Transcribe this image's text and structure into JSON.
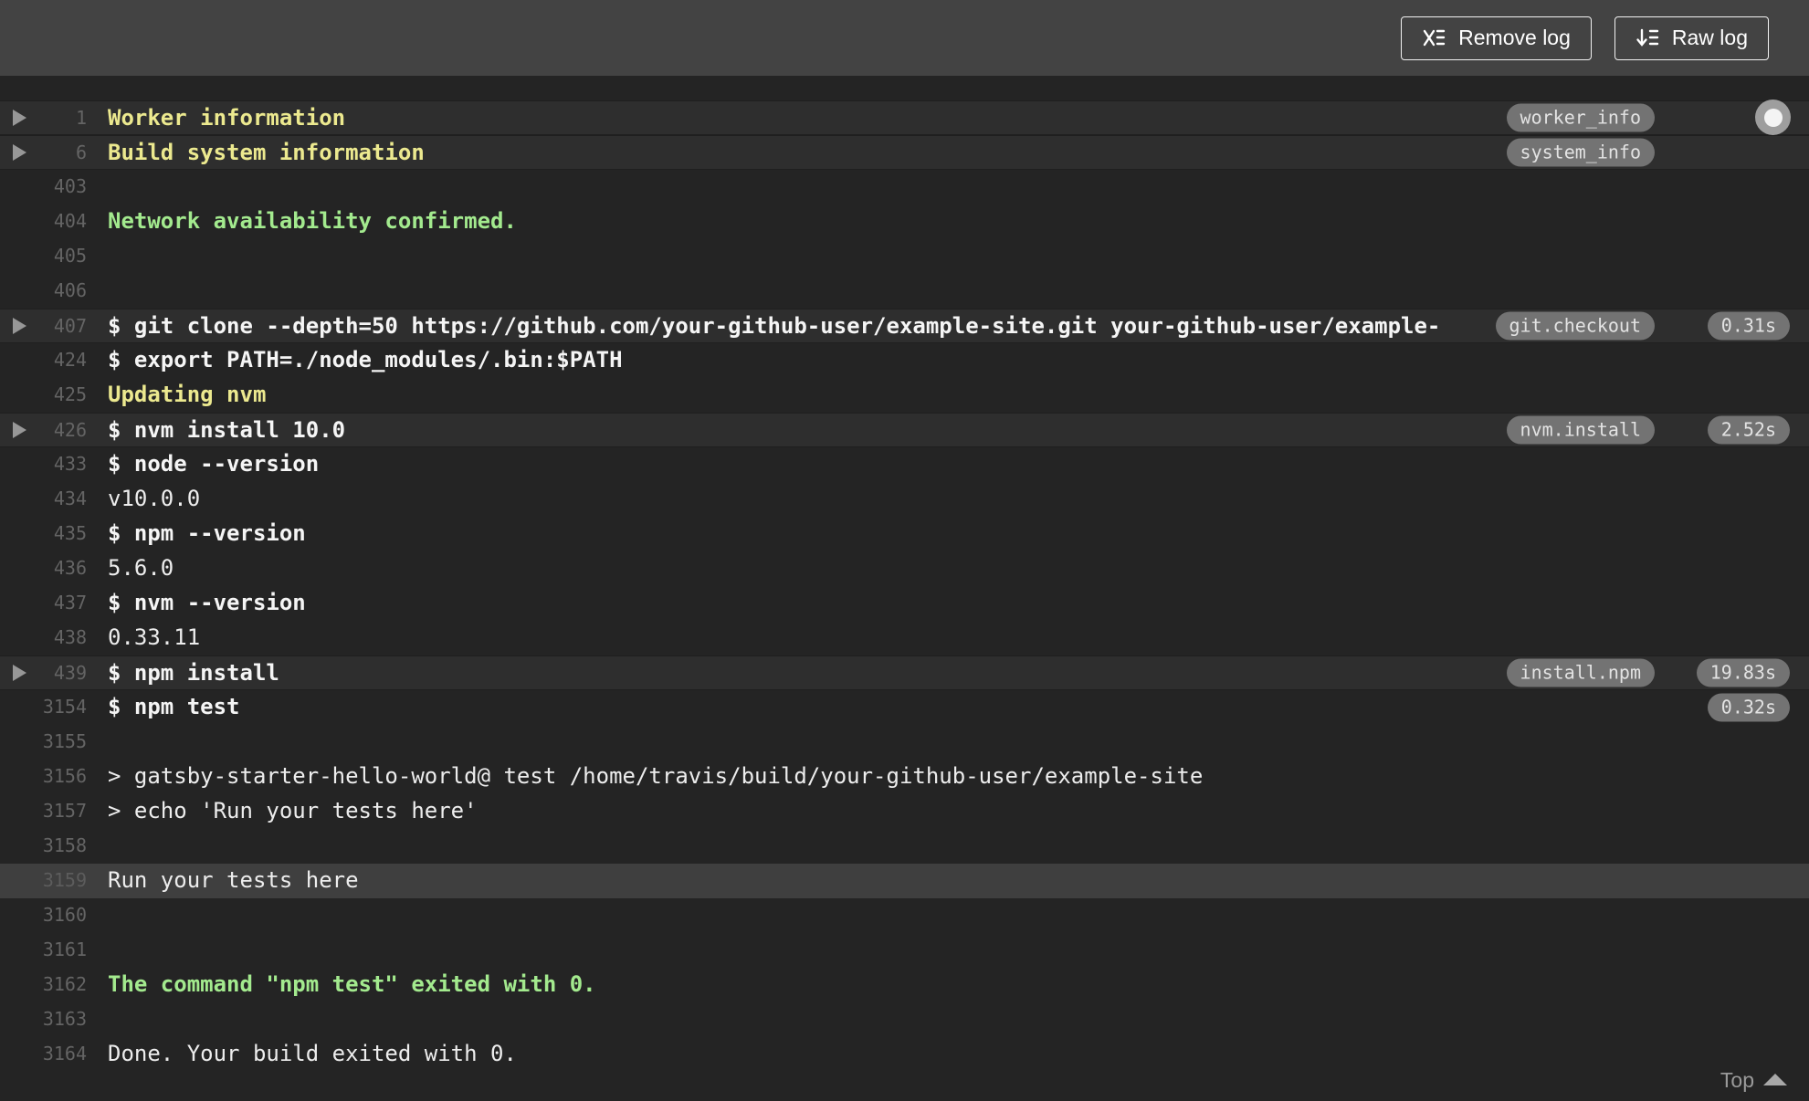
{
  "toolbar": {
    "remove_log_label": "Remove log",
    "raw_log_label": "Raw log"
  },
  "colors": {
    "topbar_bg": "#434343",
    "log_bg": "#242424",
    "fold_row_bg": "#2e2e2e",
    "selected_row_bg": "#3f3f3f",
    "command_text": "#f5f5f5",
    "output_text": "#ededed",
    "section_yellow": "#ece98f",
    "status_green": "#a3ea8e",
    "line_number": "#646464",
    "badge_bg": "#737373",
    "badge_text": "#e3e3e3"
  },
  "log": {
    "lines": [
      {
        "number": "1",
        "text": "Worker information",
        "style": "yellow",
        "fold_arrow": true,
        "badge": "worker_info",
        "timing": null,
        "row": "fold"
      },
      {
        "number": "6",
        "text": "Build system information",
        "style": "yellow",
        "fold_arrow": true,
        "badge": "system_info",
        "timing": null,
        "row": "fold"
      },
      {
        "number": "403",
        "text": "",
        "style": "out",
        "fold_arrow": false,
        "badge": null,
        "timing": null,
        "row": "normal"
      },
      {
        "number": "404",
        "text": "Network availability confirmed.",
        "style": "green",
        "fold_arrow": false,
        "badge": null,
        "timing": null,
        "row": "normal"
      },
      {
        "number": "405",
        "text": "",
        "style": "out",
        "fold_arrow": false,
        "badge": null,
        "timing": null,
        "row": "normal"
      },
      {
        "number": "406",
        "text": "",
        "style": "out",
        "fold_arrow": false,
        "badge": null,
        "timing": null,
        "row": "normal"
      },
      {
        "number": "407",
        "text": "$ git clone --depth=50 https://github.com/your-github-user/example-site.git your-github-user/example-",
        "style": "cmd",
        "fold_arrow": true,
        "badge": "git.checkout",
        "timing": "0.31s",
        "row": "fold"
      },
      {
        "number": "424",
        "text": "$ export PATH=./node_modules/.bin:$PATH",
        "style": "cmd",
        "fold_arrow": false,
        "badge": null,
        "timing": null,
        "row": "normal"
      },
      {
        "number": "425",
        "text": "Updating nvm",
        "style": "yellow",
        "fold_arrow": false,
        "badge": null,
        "timing": null,
        "row": "normal"
      },
      {
        "number": "426",
        "text": "$ nvm install 10.0",
        "style": "cmd",
        "fold_arrow": true,
        "badge": "nvm.install",
        "timing": "2.52s",
        "row": "fold"
      },
      {
        "number": "433",
        "text": "$ node --version",
        "style": "cmd",
        "fold_arrow": false,
        "badge": null,
        "timing": null,
        "row": "normal"
      },
      {
        "number": "434",
        "text": "v10.0.0",
        "style": "out",
        "fold_arrow": false,
        "badge": null,
        "timing": null,
        "row": "normal"
      },
      {
        "number": "435",
        "text": "$ npm --version",
        "style": "cmd",
        "fold_arrow": false,
        "badge": null,
        "timing": null,
        "row": "normal"
      },
      {
        "number": "436",
        "text": "5.6.0",
        "style": "out",
        "fold_arrow": false,
        "badge": null,
        "timing": null,
        "row": "normal"
      },
      {
        "number": "437",
        "text": "$ nvm --version",
        "style": "cmd",
        "fold_arrow": false,
        "badge": null,
        "timing": null,
        "row": "normal"
      },
      {
        "number": "438",
        "text": "0.33.11",
        "style": "out",
        "fold_arrow": false,
        "badge": null,
        "timing": null,
        "row": "normal"
      },
      {
        "number": "439",
        "text": "$ npm install",
        "style": "cmd",
        "fold_arrow": true,
        "badge": "install.npm",
        "timing": "19.83s",
        "row": "fold"
      },
      {
        "number": "3154",
        "text": "$ npm test",
        "style": "cmd",
        "fold_arrow": false,
        "badge": null,
        "timing": "0.32s",
        "row": "normal"
      },
      {
        "number": "3155",
        "text": "",
        "style": "out",
        "fold_arrow": false,
        "badge": null,
        "timing": null,
        "row": "normal"
      },
      {
        "number": "3156",
        "text": "> gatsby-starter-hello-world@ test /home/travis/build/your-github-user/example-site",
        "style": "out",
        "fold_arrow": false,
        "badge": null,
        "timing": null,
        "row": "normal"
      },
      {
        "number": "3157",
        "text": "> echo 'Run your tests here'",
        "style": "out",
        "fold_arrow": false,
        "badge": null,
        "timing": null,
        "row": "normal"
      },
      {
        "number": "3158",
        "text": "",
        "style": "out",
        "fold_arrow": false,
        "badge": null,
        "timing": null,
        "row": "normal"
      },
      {
        "number": "3159",
        "text": "Run your tests here",
        "style": "out",
        "fold_arrow": false,
        "badge": null,
        "timing": null,
        "row": "selected"
      },
      {
        "number": "3160",
        "text": "",
        "style": "out",
        "fold_arrow": false,
        "badge": null,
        "timing": null,
        "row": "normal"
      },
      {
        "number": "3161",
        "text": "",
        "style": "out",
        "fold_arrow": false,
        "badge": null,
        "timing": null,
        "row": "normal"
      },
      {
        "number": "3162",
        "text": "The command \"npm test\" exited with 0.",
        "style": "green",
        "fold_arrow": false,
        "badge": null,
        "timing": null,
        "row": "normal"
      },
      {
        "number": "3163",
        "text": "",
        "style": "out",
        "fold_arrow": false,
        "badge": null,
        "timing": null,
        "row": "normal"
      },
      {
        "number": "3164",
        "text": "Done. Your build exited with 0.",
        "style": "out",
        "fold_arrow": false,
        "badge": null,
        "timing": null,
        "row": "normal"
      }
    ]
  },
  "footer": {
    "top_label": "Top"
  }
}
